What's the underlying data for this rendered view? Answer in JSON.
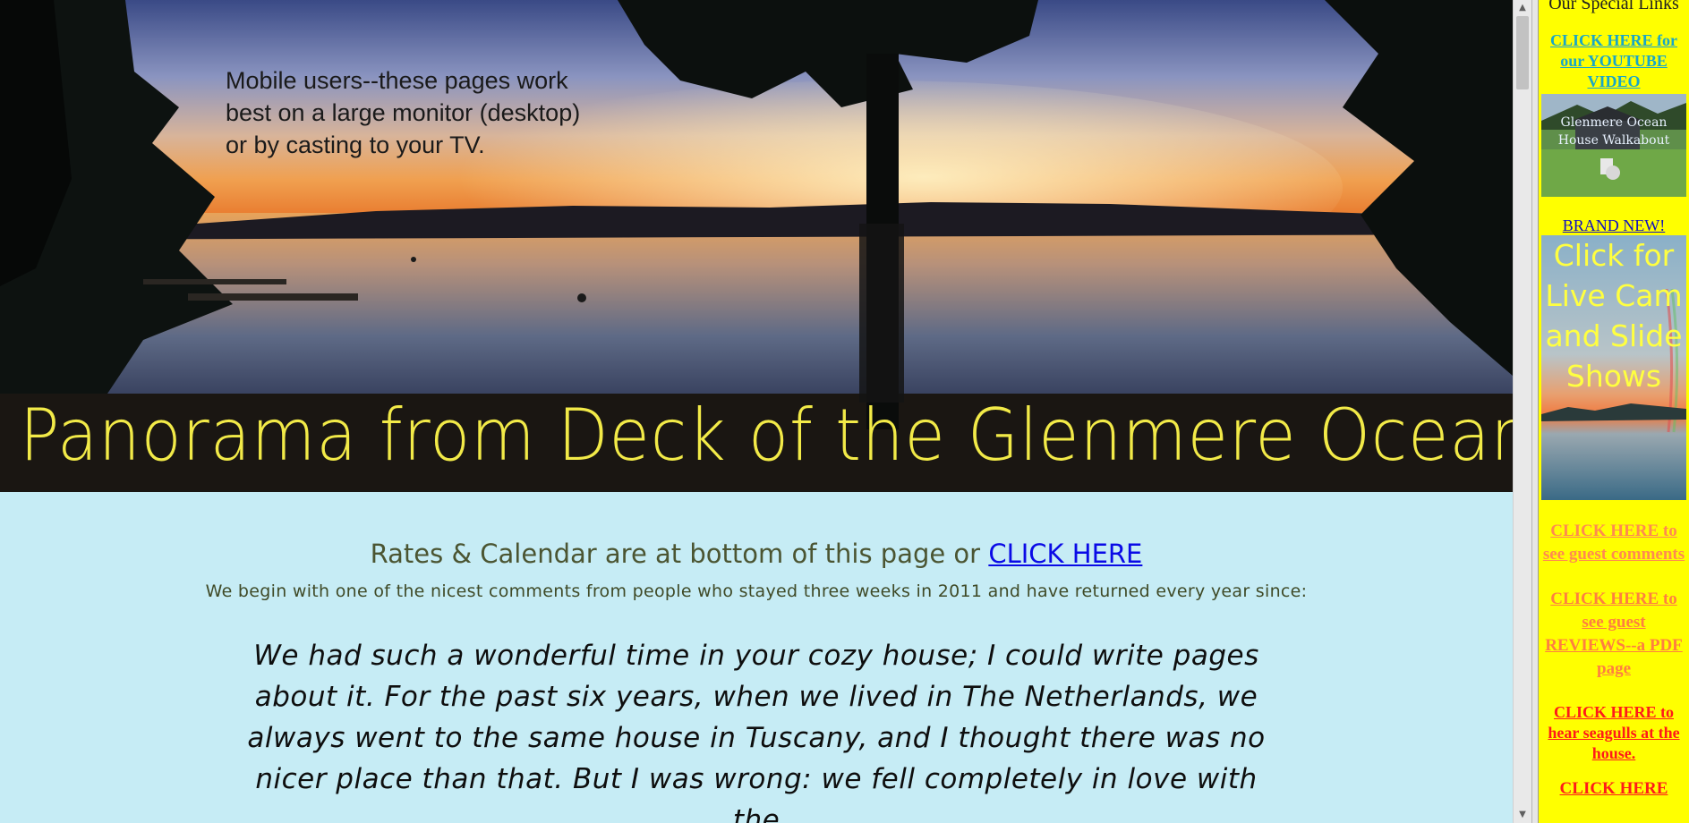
{
  "main": {
    "banner": {
      "mobile_note": "Mobile users--these pages work\nbest on a large monitor (desktop)\nor by casting to your TV.",
      "title": "Panorama from Deck of the Glenmere Ocean House"
    },
    "rates_text": "Rates & Calendar are at bottom of this page or ",
    "rates_link": "CLICK HERE",
    "intro": "We begin with one of the nicest comments from people who stayed three weeks in 2011 and have returned every year since:",
    "quote": "We had such a wonderful time in your cozy house; I could write pages about it. For the past six years, when we lived in The Netherlands, we always went to the same house in Tuscany, and I thought there was no nicer place than that. But I was wrong: we fell completely in love with the"
  },
  "side": {
    "heading": "Our Special Links",
    "youtube_link": "CLICK HERE for our YOUTUBE VIDEO",
    "thumb_caption": "Glenmere Ocean House Walkabout",
    "brand_new": "BRAND NEW!",
    "cam_text": "Click for Live Cam and Slide Shows",
    "guest_comments_link": "CLICK HERE to see guest comments",
    "reviews_link": "CLICK HERE to see guest REVIEWS--a PDF page",
    "seagulls_link": "CLICK HERE to hear seagulls at the house.",
    "last_link": "CLICK HERE"
  },
  "colors": {
    "content_bg": "#c6ecf5",
    "side_bg": "#ffff00",
    "banner_title": "#f2ea48",
    "link_blue": "#0a0ae6"
  }
}
